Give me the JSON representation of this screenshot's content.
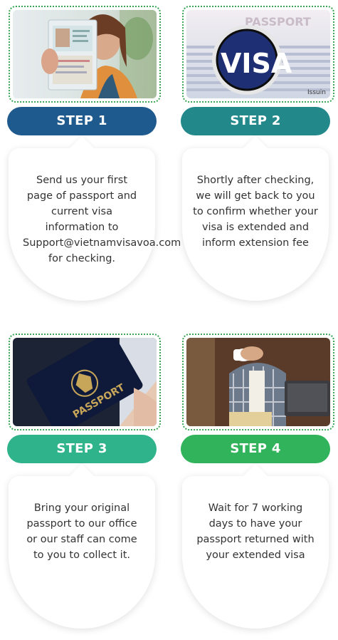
{
  "colors": {
    "step1": "#1f5a8f",
    "step2": "#23888a",
    "step3": "#2fb38a",
    "step4": "#30b35a",
    "frame": "#3aa655"
  },
  "steps": [
    {
      "label": "STEP 1",
      "photo": "person-holding-passport-photo",
      "text": "Send us your first page of passport and current visa information to Support@vietnamvisavoa.com for checking."
    },
    {
      "label": "STEP 2",
      "photo": "visa-magnifier-photo",
      "text": "Shortly after checking, we will get back to you to confirm whether your visa is extended and inform extension fee"
    },
    {
      "label": "STEP 3",
      "photo": "passport-hand-photo",
      "text": "Bring your original passport to our office or our staff can come to you to collect it."
    },
    {
      "label": "STEP 4",
      "photo": "man-with-coffee-laptop-photo",
      "text": "Wait for 7 working days to have your passport returned with your extended visa"
    }
  ],
  "photo_text": {
    "passport_word": "PASSPORT",
    "visa_word": "VISA",
    "issuing_word": "Issuin",
    "passport_cover_word": "PASSPORT"
  }
}
